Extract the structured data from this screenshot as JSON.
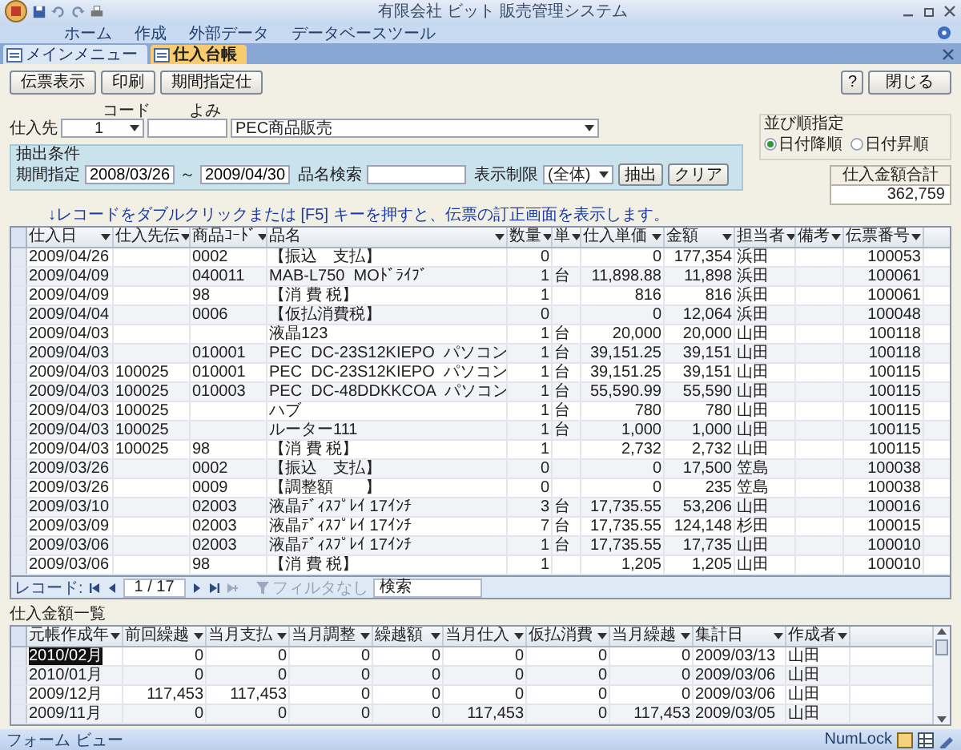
{
  "window": {
    "title": "有限会社 ビット 販売管理システム"
  },
  "ribbon_tabs": [
    "ホーム",
    "作成",
    "外部データ",
    "データベースツール"
  ],
  "document_tabs": [
    {
      "label": "メインメニュー",
      "selected": false
    },
    {
      "label": "仕入台帳",
      "selected": true
    }
  ],
  "toolbar_buttons": [
    "伝票表示",
    "印刷",
    "期間指定仕"
  ],
  "help_button": "?",
  "close_button": "閉じる",
  "supplier": {
    "label": "仕入先",
    "code_label": "コード",
    "code": "1",
    "reading_label": "よみ",
    "name": "PEC商品販売"
  },
  "filter": {
    "title": "抽出条件",
    "period_label": "期間指定",
    "from": "2008/03/26",
    "separator": "～",
    "to": "2009/04/30",
    "search_label": "品名検索",
    "limit_label": "表示制限",
    "limit": "(全体)",
    "extract_button": "抽出",
    "clear_button": "クリア"
  },
  "sort": {
    "title": "並び順指定",
    "options": [
      {
        "label": "日付降順",
        "selected": true
      },
      {
        "label": "日付昇順",
        "selected": false
      }
    ]
  },
  "total": {
    "label": "仕入金額合計",
    "value": "362,759"
  },
  "hint": "↓レコードをダブルクリックまたは [F5] キーを押すと、伝票の訂正画面を表示します。",
  "table": {
    "columns": [
      "仕入日",
      "仕入先伝",
      "商品ｺｰﾄﾞ",
      "品名",
      "数量",
      "単",
      "仕入単価",
      "金額",
      "担当者",
      "備考",
      "伝票番号"
    ],
    "rows": [
      [
        "2009/04/26",
        null,
        "0002",
        "【振込　支払】",
        "0",
        null,
        "0",
        "177,354",
        "浜田",
        null,
        "100053"
      ],
      [
        "2009/04/09",
        null,
        "040011",
        "MAB-L750  MOﾄﾞﾗｲﾌﾞ",
        "1",
        "台",
        "11,898.88",
        "11,898",
        "浜田",
        null,
        "100061"
      ],
      [
        "2009/04/09",
        null,
        "98",
        "【消 費 税】",
        "1",
        null,
        "816",
        "816",
        "浜田",
        null,
        "100061"
      ],
      [
        "2009/04/04",
        null,
        "0006",
        "【仮払消費税】",
        "0",
        null,
        "0",
        "12,064",
        "浜田",
        null,
        "100048"
      ],
      [
        "2009/04/03",
        null,
        null,
        "液晶123",
        "1",
        "台",
        "20,000",
        "20,000",
        "山田",
        null,
        "100118"
      ],
      [
        "2009/04/03",
        null,
        "010001",
        "PEC  DC-23S12KIEPO  パソコン",
        "1",
        "台",
        "39,151.25",
        "39,151",
        "山田",
        null,
        "100118"
      ],
      [
        "2009/04/03",
        "100025",
        "010001",
        "PEC  DC-23S12KIEPO  パソコン",
        "1",
        "台",
        "39,151.25",
        "39,151",
        "山田",
        null,
        "100115"
      ],
      [
        "2009/04/03",
        "100025",
        "010003",
        "PEC  DC-48DDKKCOA  パソコン",
        "1",
        "台",
        "55,590.99",
        "55,590",
        "山田",
        null,
        "100115"
      ],
      [
        "2009/04/03",
        "100025",
        null,
        "ハブ",
        "1",
        "台",
        "780",
        "780",
        "山田",
        null,
        "100115"
      ],
      [
        "2009/04/03",
        "100025",
        null,
        "ルーター111",
        "1",
        "台",
        "1,000",
        "1,000",
        "山田",
        null,
        "100115"
      ],
      [
        "2009/04/03",
        "100025",
        "98",
        "【消 費 税】",
        "1",
        null,
        "2,732",
        "2,732",
        "山田",
        null,
        "100115"
      ],
      [
        "2009/03/26",
        null,
        "0002",
        "【振込　支払】",
        "0",
        null,
        "0",
        "17,500",
        "笠島",
        null,
        "100038"
      ],
      [
        "2009/03/26",
        null,
        "0009",
        "【調整額　　】",
        "0",
        null,
        "0",
        "235",
        "笠島",
        null,
        "100038"
      ],
      [
        "2009/03/10",
        null,
        "02003",
        "液晶ﾃﾞｨｽﾌﾟﾚｲ 17ｲﾝﾁ",
        "3",
        "台",
        "17,735.55",
        "53,206",
        "山田",
        null,
        "100016"
      ],
      [
        "2009/03/09",
        null,
        "02003",
        "液晶ﾃﾞｨｽﾌﾟﾚｲ 17ｲﾝﾁ",
        "7",
        "台",
        "17,735.55",
        "124,148",
        "杉田",
        null,
        "100015"
      ],
      [
        "2009/03/06",
        null,
        "02003",
        "液晶ﾃﾞｨｽﾌﾟﾚｲ 17ｲﾝﾁ",
        "1",
        "台",
        "17,735.55",
        "17,735",
        "山田",
        null,
        "100010"
      ],
      [
        "2009/03/06",
        null,
        "98",
        "【消 費 税】",
        "1",
        null,
        "1,205",
        "1,205",
        "山田",
        null,
        "100010"
      ]
    ]
  },
  "navigation": {
    "label": "レコード:",
    "position": "1 / 17",
    "filter": "フィルタなし",
    "search": "検索"
  },
  "summary": {
    "title": "仕入金額一覧",
    "columns": [
      "元帳作成年",
      "前回繰越",
      "当月支払",
      "当月調整",
      "繰越額",
      "当月仕入",
      "仮払消費",
      "当月繰越",
      "集計日",
      "作成者"
    ],
    "rows": [
      {
        "selected": true,
        "cells": [
          "2010/02月",
          "0",
          "0",
          "0",
          "0",
          "0",
          "0",
          "0",
          "2009/03/13",
          "山田"
        ]
      },
      {
        "selected": false,
        "cells": [
          "2010/01月",
          "0",
          "0",
          "0",
          "0",
          "0",
          "0",
          "0",
          "2009/03/06",
          "山田"
        ]
      },
      {
        "selected": false,
        "cells": [
          "2009/12月",
          "117,453",
          "117,453",
          "0",
          "0",
          "0",
          "0",
          "0",
          "2009/03/06",
          "山田"
        ]
      },
      {
        "selected": false,
        "cells": [
          "2009/11月",
          "0",
          "0",
          "0",
          "0",
          "117,453",
          "0",
          "117,453",
          "2009/03/05",
          "山田"
        ]
      }
    ]
  },
  "status_bar": {
    "left": "フォーム ビュー",
    "right": "NumLock"
  }
}
